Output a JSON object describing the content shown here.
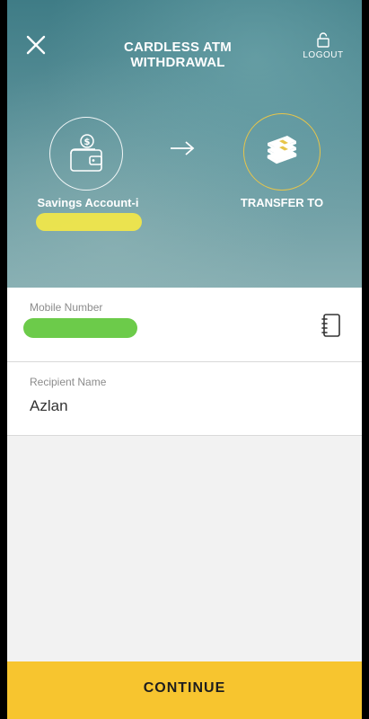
{
  "header": {
    "title": "CARDLESS ATM WITHDRAWAL",
    "logout_label": "LOGOUT",
    "close_icon": "close-icon",
    "lock_icon": "lock-icon"
  },
  "transfer": {
    "from_account": "Savings Account-i",
    "from_icon": "wallet-icon",
    "arrow_icon": "arrow-right-icon",
    "to_label": "TRANSFER TO",
    "to_icon": "money-stack-icon"
  },
  "form": {
    "mobile_label": "Mobile Number",
    "contacts_icon": "address-book-icon",
    "recipient_label": "Recipient Name",
    "recipient_value": "Azlan"
  },
  "footer": {
    "continue_label": "CONTINUE"
  },
  "colors": {
    "accent_yellow": "#f7c52f",
    "circle_gold": "#e7c54a",
    "header_teal": "#4f8790",
    "redaction_yellow": "#f0e64a",
    "redaction_green": "#6ccb4a"
  }
}
